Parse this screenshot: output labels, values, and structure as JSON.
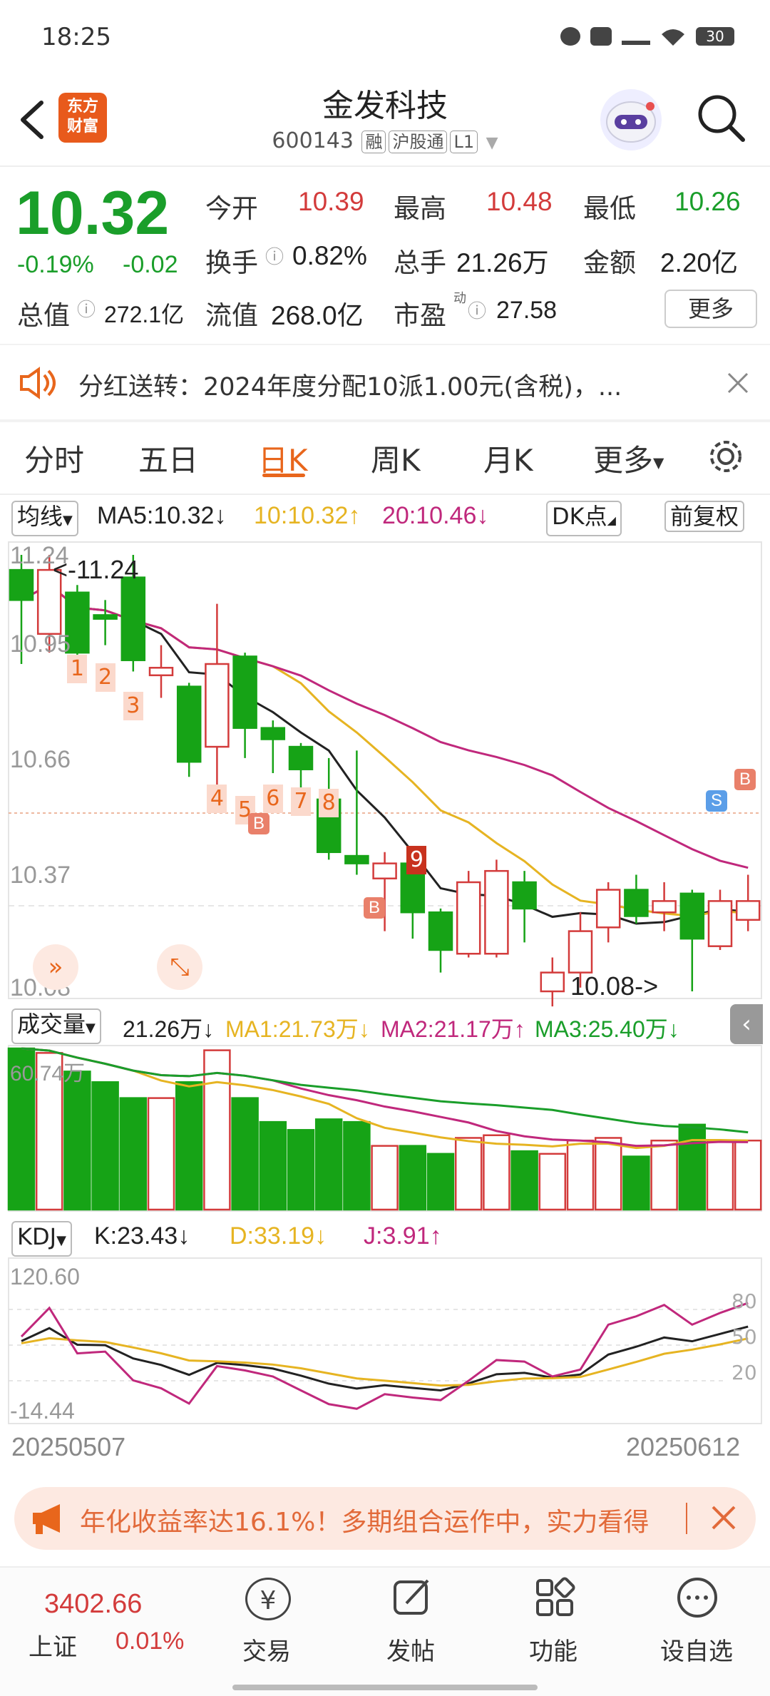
{
  "status": {
    "time": "18:25",
    "battery": "30"
  },
  "header": {
    "name": "金发科技",
    "code": "600143",
    "tags": [
      "融",
      "沪股通",
      "L1"
    ],
    "logo_line1": "东方",
    "logo_line2": "财富"
  },
  "quote": {
    "price": "10.32",
    "change_pct": "-0.19%",
    "change": "-0.02",
    "open_label": "今开",
    "open": "10.39",
    "high_label": "最高",
    "high": "10.48",
    "low_label": "最低",
    "low": "10.26",
    "turnover_label": "换手",
    "turnover": "0.82%",
    "volume_label": "总手",
    "volume": "21.26万",
    "amount_label": "金额",
    "amount": "2.20亿",
    "mktcap_label": "总值",
    "mktcap": "272.1亿",
    "float_label": "流值",
    "float": "268.0亿",
    "pe_label": "市盈",
    "pe_sup": "动",
    "pe": "27.58",
    "more": "更多"
  },
  "notice": {
    "text": "分红送转：2024年度分配10派1.00元(含税)，..."
  },
  "tabs": [
    "分时",
    "五日",
    "日K",
    "周K",
    "月K",
    "更多"
  ],
  "active_tab": 2,
  "ma": {
    "selector": "均线",
    "ma5": "MA5:10.32↓",
    "ma10": "10:10.32↑",
    "ma20": "20:10.46↓",
    "dk": "DK点",
    "adjust": "前复权",
    "colors": {
      "ma5": "#222222",
      "ma10": "#e6b422",
      "ma20": "#c0287c"
    }
  },
  "kline": {
    "y_ticks": [
      "11.24",
      "10.95",
      "10.66",
      "10.37",
      "10.08"
    ],
    "max_label": "<-11.24",
    "min_label": "10.08->",
    "signals_digits": [
      "1",
      "2",
      "3",
      "4",
      "5",
      "6",
      "7",
      "8",
      "9"
    ]
  },
  "volume": {
    "selector": "成交量",
    "current": "21.26万↓",
    "ma1": "MA1:21.73万↓",
    "ma2": "MA2:21.17万↑",
    "ma3": "MA3:25.40万↓",
    "max": "60.74万"
  },
  "kdj": {
    "selector": "KDJ",
    "k": "K:23.43↓",
    "d": "D:33.19↓",
    "j": "J:3.91↑",
    "max": "120.60",
    "min": "-14.44",
    "levels": [
      "80",
      "50",
      "20"
    ]
  },
  "dates": {
    "start": "20250507",
    "end": "20250612"
  },
  "banner": {
    "text": "年化收益率达16.1%！多期组合运作中，实力看得"
  },
  "bottom": {
    "index_value": "3402.66",
    "index_name": "上证",
    "index_pct": "0.01%",
    "items": [
      "交易",
      "发帖",
      "功能",
      "设自选"
    ]
  },
  "chart_data": {
    "type": "candlestick",
    "dates_range": [
      "20250507",
      "20250612"
    ],
    "up_color": "#d33b3b",
    "down_color": "#16a316",
    "ylim": [
      10.08,
      11.24
    ],
    "candles": [
      {
        "o": 11.2,
        "h": 11.24,
        "l": 10.95,
        "c": 11.12
      },
      {
        "o": 11.03,
        "h": 11.24,
        "l": 10.98,
        "c": 11.2
      },
      {
        "o": 11.14,
        "h": 11.16,
        "l": 10.91,
        "c": 10.98
      },
      {
        "o": 11.08,
        "h": 11.12,
        "l": 11.0,
        "c": 11.07
      },
      {
        "o": 11.18,
        "h": 11.24,
        "l": 10.93,
        "c": 10.96
      },
      {
        "o": 10.92,
        "h": 11.0,
        "l": 10.86,
        "c": 10.94
      },
      {
        "o": 10.89,
        "h": 10.9,
        "l": 10.65,
        "c": 10.69
      },
      {
        "o": 10.73,
        "h": 11.11,
        "l": 10.6,
        "c": 10.95
      },
      {
        "o": 10.97,
        "h": 10.98,
        "l": 10.7,
        "c": 10.78
      },
      {
        "o": 10.78,
        "h": 10.8,
        "l": 10.66,
        "c": 10.75
      },
      {
        "o": 10.73,
        "h": 10.74,
        "l": 10.62,
        "c": 10.67
      },
      {
        "o": 10.59,
        "h": 10.7,
        "l": 10.43,
        "c": 10.45
      },
      {
        "o": 10.44,
        "h": 10.72,
        "l": 10.39,
        "c": 10.42
      },
      {
        "o": 10.38,
        "h": 10.45,
        "l": 10.24,
        "c": 10.42
      },
      {
        "o": 10.42,
        "h": 10.43,
        "l": 10.22,
        "c": 10.29
      },
      {
        "o": 10.29,
        "h": 10.3,
        "l": 10.13,
        "c": 10.19
      },
      {
        "o": 10.18,
        "h": 10.4,
        "l": 10.17,
        "c": 10.37
      },
      {
        "o": 10.18,
        "h": 10.43,
        "l": 10.17,
        "c": 10.4
      },
      {
        "o": 10.37,
        "h": 10.4,
        "l": 10.21,
        "c": 10.3
      },
      {
        "o": 10.08,
        "h": 10.17,
        "l": 10.04,
        "c": 10.13
      },
      {
        "o": 10.13,
        "h": 10.29,
        "l": 10.09,
        "c": 10.24
      },
      {
        "o": 10.25,
        "h": 10.37,
        "l": 10.21,
        "c": 10.35
      },
      {
        "o": 10.35,
        "h": 10.39,
        "l": 10.26,
        "c": 10.28
      },
      {
        "o": 10.29,
        "h": 10.37,
        "l": 10.24,
        "c": 10.32
      },
      {
        "o": 10.34,
        "h": 10.35,
        "l": 10.08,
        "c": 10.22
      },
      {
        "o": 10.2,
        "h": 10.35,
        "l": 10.19,
        "c": 10.32
      },
      {
        "o": 10.27,
        "h": 10.39,
        "l": 10.24,
        "c": 10.32
      }
    ],
    "volumes": [
      60.7,
      59.0,
      52.0,
      48.0,
      42.0,
      42.0,
      48.0,
      60.0,
      42.0,
      33.0,
      30.0,
      34.0,
      33.0,
      24.0,
      24.0,
      21.0,
      27.0,
      28.0,
      22.0,
      21.0,
      26.0,
      27.0,
      20.0,
      26.0,
      32.0,
      26.0,
      26.0
    ]
  }
}
